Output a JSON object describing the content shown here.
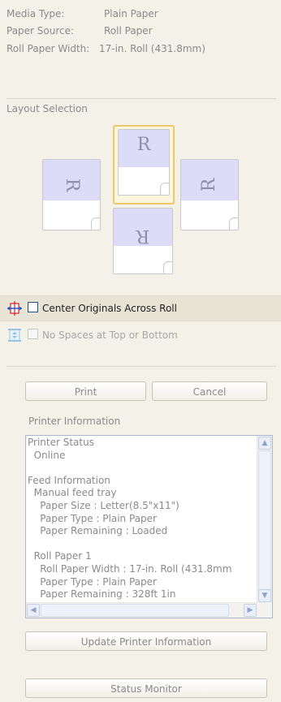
{
  "media_info": {
    "rows": [
      {
        "label": "Media Type:",
        "value": "Plain Paper"
      },
      {
        "label": "Paper Source:",
        "value": "Roll Paper"
      },
      {
        "label": "Roll Paper Width:",
        "value": "17-in. Roll (431.8mm)"
      }
    ]
  },
  "layout": {
    "title": "Layout Selection",
    "tiles": [
      {
        "name": "rotate-left",
        "glyph": "R",
        "selected": false
      },
      {
        "name": "normal",
        "glyph": "R",
        "selected": true
      },
      {
        "name": "rotate-right",
        "glyph": "R",
        "selected": false
      },
      {
        "name": "rotate-180",
        "glyph": "R",
        "selected": false
      }
    ]
  },
  "options": {
    "center_originals": {
      "label": "Center Originals Across Roll",
      "checked": false,
      "enabled": true
    },
    "no_spaces": {
      "label": "No Spaces at Top or Bottom",
      "checked": false,
      "enabled": false
    }
  },
  "buttons": {
    "print": "Print",
    "cancel": "Cancel",
    "update": "Update Printer Information",
    "status_monitor": "Status Monitor"
  },
  "printer_info": {
    "title": "Printer Information",
    "lines": [
      "Printer Status",
      "  Online",
      "",
      "Feed Information",
      "  Manual feed tray",
      "    Paper Size : Letter(8.5\"x11\")",
      "    Paper Type : Plain Paper",
      "    Paper Remaining : Loaded",
      "",
      "  Roll Paper 1",
      "    Roll Paper Width : 17-in. Roll (431.8mm",
      "    Paper Type : Plain Paper",
      "    Paper Remaining : 328ft 1in"
    ]
  },
  "icons": {
    "scroll_up": "scroll-up-arrow-icon",
    "scroll_down": "scroll-down-arrow-icon",
    "scroll_left": "scroll-left-arrow-icon",
    "scroll_right": "scroll-right-arrow-icon",
    "center": "center-crosshair-icon",
    "no_spaces": "vertical-compress-icon"
  }
}
